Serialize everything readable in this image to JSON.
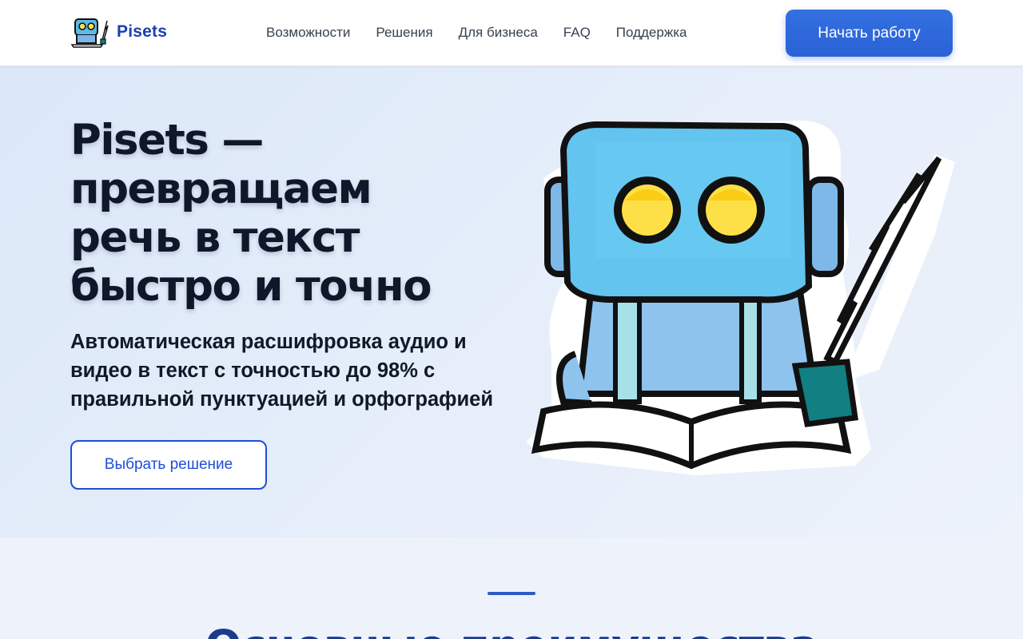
{
  "header": {
    "logo_text": "Pisets",
    "nav": [
      "Возможности",
      "Решения",
      "Для бизнеса",
      "FAQ",
      "Поддержка"
    ],
    "cta_label": "Начать работу"
  },
  "hero": {
    "title": "Pisets —\nпревращаем\nречь в текст\nбыстро и точно",
    "subtitle": "Автоматическая расшифровка аудио и видео в текст с точностью до 98% с правильной пунктуацией и орфографией",
    "button_label": "Выбрать решение"
  },
  "section": {
    "title": "Основные преимущества"
  },
  "colors": {
    "brand": "#1e40af",
    "accent": "#2a62d6",
    "hero_bg": "#e2ecf9"
  }
}
